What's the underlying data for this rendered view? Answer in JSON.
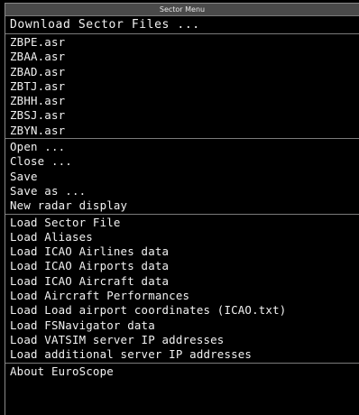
{
  "menu": {
    "title": "Sector Menu",
    "download": "Download Sector Files ...",
    "sector_files": [
      "ZBPE.asr",
      "ZBAA.asr",
      "ZBAD.asr",
      "ZBTJ.asr",
      "ZBHH.asr",
      "ZBSJ.asr",
      "ZBYN.asr"
    ],
    "file_actions": [
      "Open ...",
      "Close ...",
      "Save",
      "Save as ...",
      "New radar display"
    ],
    "load_actions": [
      "Load Sector File",
      "Load Aliases",
      "Load ICAO Airlines data",
      "Load ICAO Airports data",
      "Load ICAO Aircraft data",
      "Load Aircraft Performances",
      "Load Load airport coordinates (ICAO.txt)",
      "Load FSNavigator data",
      "Load VATSIM server IP addresses",
      "Load additional server IP addresses"
    ],
    "about": "About EuroScope"
  },
  "colors": {
    "background": "#000000",
    "text": "#f2f2f2",
    "titlebar": "#4a4a4a",
    "separator": "#7a7a7a"
  }
}
